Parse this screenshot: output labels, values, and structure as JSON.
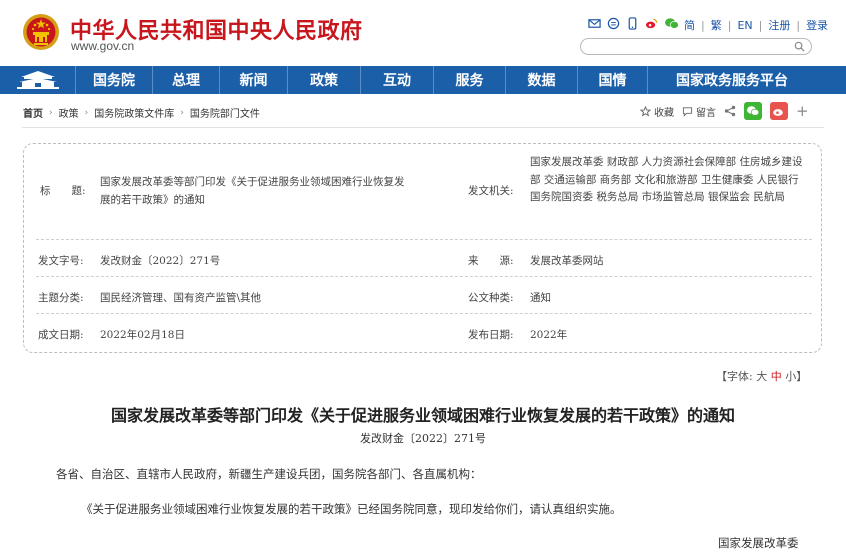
{
  "header": {
    "site_title": "中华人民共和国中央人民政府",
    "site_url": "www.gov.cn",
    "top_links": [
      "简",
      "繁",
      "EN",
      "注册",
      "登录"
    ]
  },
  "nav": {
    "items": [
      "国务院",
      "总理",
      "新闻",
      "政策",
      "互动",
      "服务",
      "数据",
      "国情",
      "国家政务服务平台"
    ]
  },
  "breadcrumb": [
    "首页",
    "政策",
    "国务院政策文件库",
    "国务院部门文件"
  ],
  "tools": {
    "favorite": "收藏",
    "message": "留言"
  },
  "info": {
    "title_label": "标　　题:",
    "title_value": "国家发展改革委等部门印发《关于促进服务业领域困难行业恢复发展的若干政策》的通知",
    "issuer_label": "发文机关:",
    "issuer_value": "国家发展改革委 财政部 人力资源社会保障部 住房城乡建设部 交通运输部 商务部 文化和旅游部 卫生健康委 人民银行 国务院国资委 税务总局 市场监管总局 银保监会 民航局",
    "docno_label": "发文字号:",
    "docno_value": "发改财金〔2022〕271号",
    "source_label": "来　　源:",
    "source_value": "发展改革委网站",
    "topic_label": "主题分类:",
    "topic_value": "国民经济管理、国有资产监管\\其他",
    "type_label": "公文种类:",
    "type_value": "通知",
    "written_label": "成文日期:",
    "written_value": "2022年02月18日",
    "published_label": "发布日期:",
    "published_value": "2022年"
  },
  "font_size": {
    "prefix": "【字体:",
    "large": "大",
    "medium": "中",
    "small": "小",
    "suffix": "】"
  },
  "article": {
    "title": "国家发展改革委等部门印发《关于促进服务业领域困难行业恢复发展的若干政策》的通知",
    "doc_no": "发改财金〔2022〕271号",
    "salutation": "各省、自治区、直辖市人民政府，新疆生产建设兵团，国务院各部门、各直属机构：",
    "paragraph1": "《关于促进服务业领域困难行业恢复发展的若干政策》已经国务院同意，现印发给你们，请认真组织实施。",
    "signature": "国家发展改革委"
  },
  "colors": {
    "brand_red": "#c8161d",
    "nav_blue": "#1a5fa8",
    "link_blue": "#1a55a8"
  }
}
